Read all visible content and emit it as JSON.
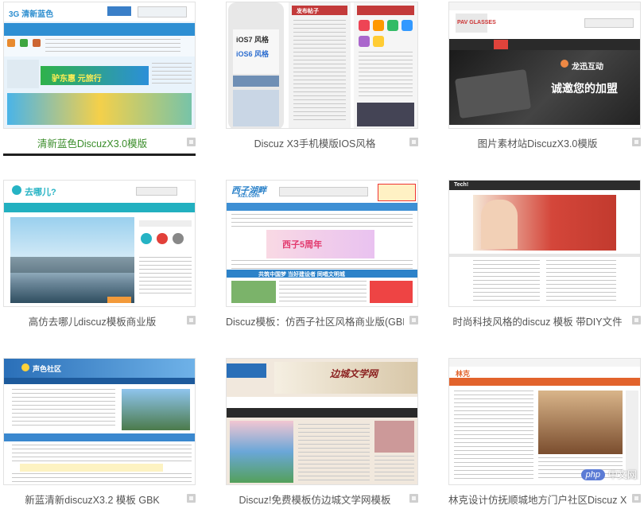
{
  "templates": [
    {
      "caption": "清新蓝色DiscuzX3.0模版",
      "active": true
    },
    {
      "caption": "Discuz X3手机模版IOS风格",
      "active": false
    },
    {
      "caption": "图片素材站DiscuzX3.0模版",
      "active": false
    },
    {
      "caption": "高仿去哪儿discuz模板商业版",
      "active": false
    },
    {
      "caption": "Discuz模板：仿西子社区风格商业版(GBK)免",
      "active": false
    },
    {
      "caption": "时尚科技风格的discuz 模板 带DIY文件",
      "active": false
    },
    {
      "caption": "新蓝清新discuzX3.2 模板 GBK",
      "active": false
    },
    {
      "caption": "Discuz!免费模板仿边城文学网模板",
      "active": false
    },
    {
      "caption": "林克设计仿抚顺城地方门户社区Discuz X3模",
      "active": false
    }
  ],
  "previews": {
    "p1_logo": "3G 清新蓝色",
    "p1_promo": "驴东惠 元旅行",
    "p2_ios7": "iOS7 风格",
    "p2_ios6": "iOS6 风格",
    "p2_tab": "发布帖子",
    "p3_brand": "PAV GLASSES",
    "p3_company": "龙迅互动",
    "p3_slogan": "诚邀您的加盟",
    "p4_logo": "去哪儿?",
    "p5_logo": "西子湖畔",
    "p5_domain": "xizi.com",
    "p5_banner": "西子5周年",
    "p5_strip": "共筑中国梦 当好建设者 同唱文明城",
    "p6_logo": "Tech!",
    "p7_logo": "声色社区",
    "p8_logo": "边城文学网",
    "p9_logo": "林克"
  },
  "watermark": {
    "badge": "php",
    "text": "中文网"
  }
}
